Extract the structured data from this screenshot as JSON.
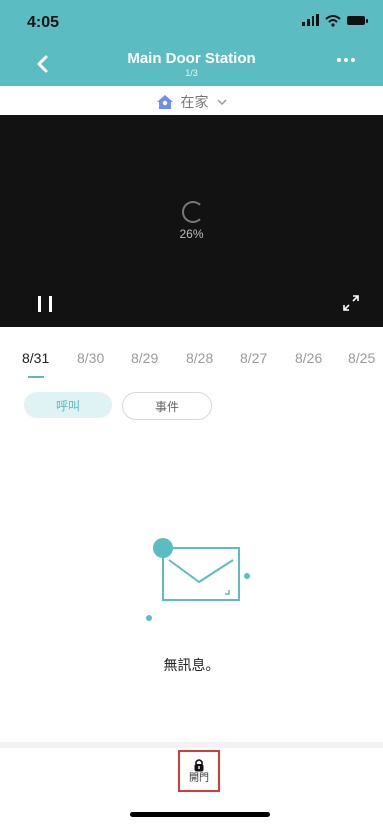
{
  "status_bar": {
    "time": "4:05"
  },
  "nav": {
    "title": "Main Door Station",
    "subtitle": "1/3"
  },
  "mode": {
    "label": "在家"
  },
  "video": {
    "progress_text": "26%"
  },
  "dates": {
    "items": [
      "8/31",
      "8/30",
      "8/29",
      "8/28",
      "8/27",
      "8/26",
      "8/25"
    ],
    "selected_index": 0
  },
  "tabs": [
    {
      "label": "呼叫",
      "active": true
    },
    {
      "label": "事件",
      "active": false
    }
  ],
  "empty_state": {
    "text": "無訊息。"
  },
  "bottom_bar": {
    "open_door_label": "開門"
  },
  "colors": {
    "primary": "#5bbcc1",
    "highlight_border": "#d53a3a",
    "video_bg": "#121212"
  },
  "icons": {
    "back": "chevron-left-icon",
    "more": "more-dots-icon",
    "home_mode": "home-icon",
    "dropdown": "chevron-down-icon",
    "pause": "pause-icon",
    "fullscreen": "fullscreen-icon",
    "lock": "lock-icon",
    "mail": "envelope-icon"
  }
}
